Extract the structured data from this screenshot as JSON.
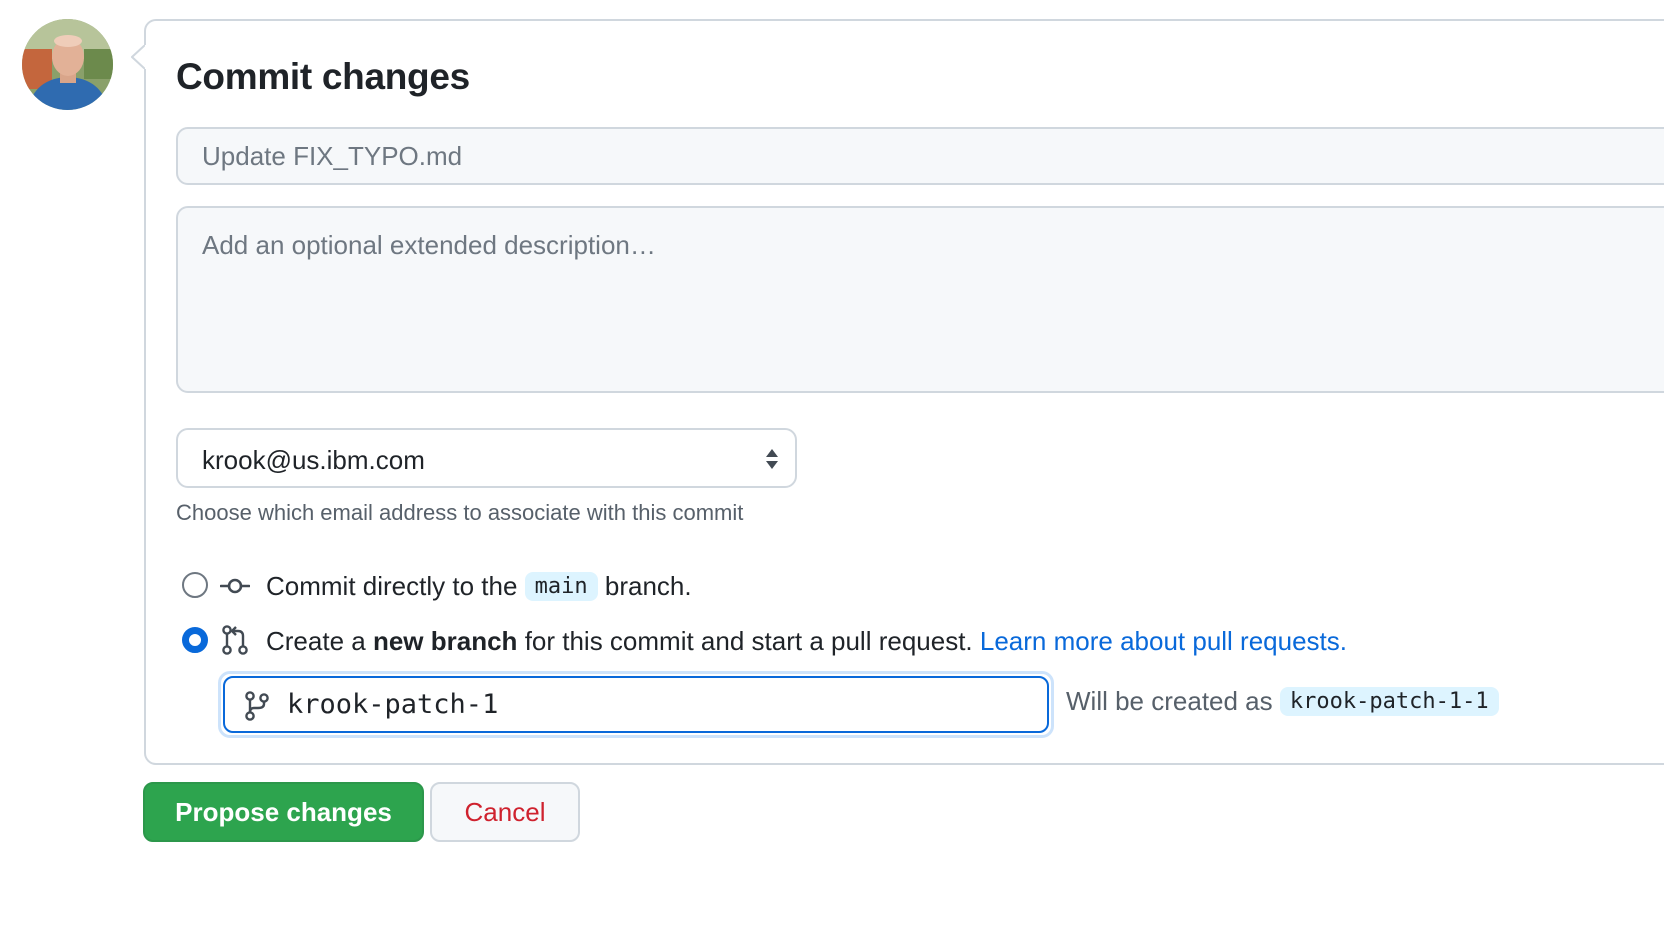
{
  "avatar": {
    "alt": "User avatar"
  },
  "form": {
    "title": "Commit changes",
    "summary_placeholder": "Update FIX_TYPO.md",
    "description_placeholder": "Add an optional extended description…",
    "email": {
      "selected": "krook@us.ibm.com",
      "hint": "Choose which email address to associate with this commit"
    },
    "options": {
      "direct": {
        "prefix": "Commit directly to the",
        "branch": "main",
        "suffix": "branch.",
        "checked": false
      },
      "new_branch": {
        "prefix": "Create a",
        "bold": "new branch",
        "suffix": "for this commit and start a pull request.",
        "link": "Learn more about pull requests.",
        "checked": true
      }
    },
    "branch_name": "krook-patch-1",
    "will_be_created": {
      "label": "Will be created as",
      "name": "krook-patch-1-1"
    }
  },
  "buttons": {
    "propose": "Propose changes",
    "cancel": "Cancel"
  },
  "colors": {
    "primary_green": "#2da44e",
    "link_blue": "#0969da",
    "danger_red": "#cf222e"
  },
  "icons": {
    "commit": "git-commit-icon",
    "pull_request": "git-pull-request-icon",
    "branch": "git-branch-icon",
    "select": "select-arrows-icon"
  }
}
